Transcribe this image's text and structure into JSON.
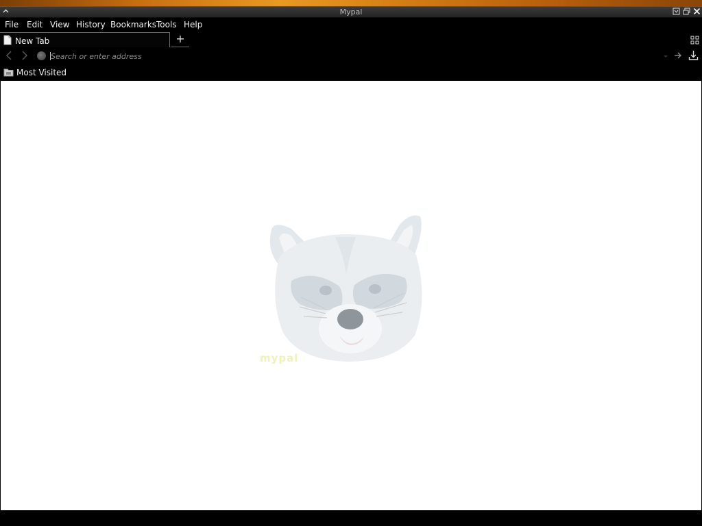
{
  "window": {
    "title": "Mypal"
  },
  "menu": {
    "items": [
      "File",
      "Edit",
      "View",
      "History",
      "Bookmarks",
      "Tools",
      "Help"
    ]
  },
  "tabs": [
    {
      "label": "New Tab",
      "active": true
    }
  ],
  "newtab": {
    "label": "+"
  },
  "address": {
    "placeholder": "Search or enter address",
    "value": ""
  },
  "bookmarks": {
    "items": [
      {
        "label": "Most Visited",
        "icon": "folder-icon"
      }
    ]
  },
  "content": {
    "logo": {
      "description_icon": "raccoon-logo",
      "text": "mypal"
    }
  },
  "colors": {
    "chrome": "#000000",
    "content_bg": "#ffffff",
    "desktop": "#c96f10"
  }
}
